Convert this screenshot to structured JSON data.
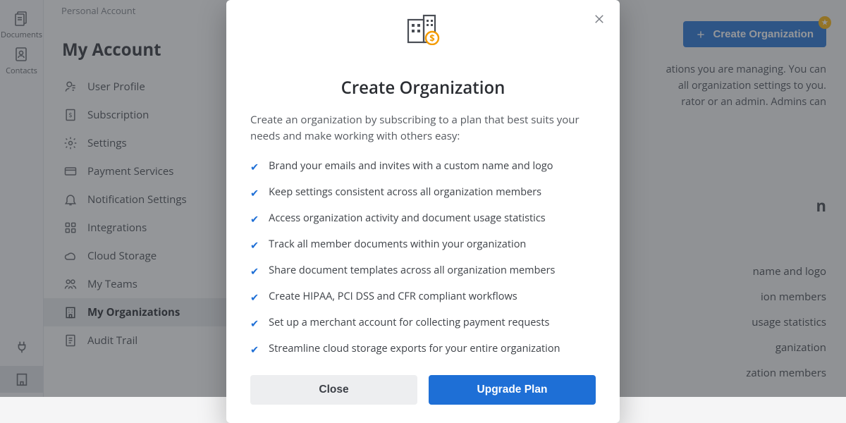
{
  "rail": {
    "documents": "Documents",
    "contacts": "Contacts"
  },
  "account_label": "Personal Account",
  "sidebar": {
    "title": "My Account",
    "items": [
      {
        "label": "User Profile",
        "icon": "user-profile"
      },
      {
        "label": "Subscription",
        "icon": "subscription"
      },
      {
        "label": "Settings",
        "icon": "settings"
      },
      {
        "label": "Payment Services",
        "icon": "payment"
      },
      {
        "label": "Notification Settings",
        "icon": "notification"
      },
      {
        "label": "Integrations",
        "icon": "integrations"
      },
      {
        "label": "Cloud Storage",
        "icon": "cloud"
      },
      {
        "label": "My Teams",
        "icon": "teams"
      },
      {
        "label": "My Organizations",
        "icon": "organizations"
      },
      {
        "label": "Audit Trail",
        "icon": "audit"
      }
    ]
  },
  "content": {
    "create_button": "Create Organization",
    "desc_fragments": [
      "ations you are managing. You can",
      "all organization settings to you.",
      "rator or an admin. Admins can"
    ],
    "heading_fragment": "n",
    "partial_bullets": [
      "name and logo",
      "ion members",
      "usage statistics",
      "ganization",
      "zation members"
    ]
  },
  "modal": {
    "title": "Create Organization",
    "lead": "Create an organization by subscribing to a plan that best suits your needs and make working with others easy:",
    "features": [
      "Brand your emails and invites with a custom name and logo",
      "Keep settings consistent across all organization members",
      "Access organization activity and document usage statistics",
      "Track all member documents within your organization",
      "Share document templates across all organization members",
      "Create HIPAA, PCI DSS and CFR compliant workflows",
      "Set up a merchant account for collecting payment requests",
      "Streamline cloud storage exports for your entire organization"
    ],
    "close_btn": "Close",
    "upgrade_btn": "Upgrade Plan"
  }
}
